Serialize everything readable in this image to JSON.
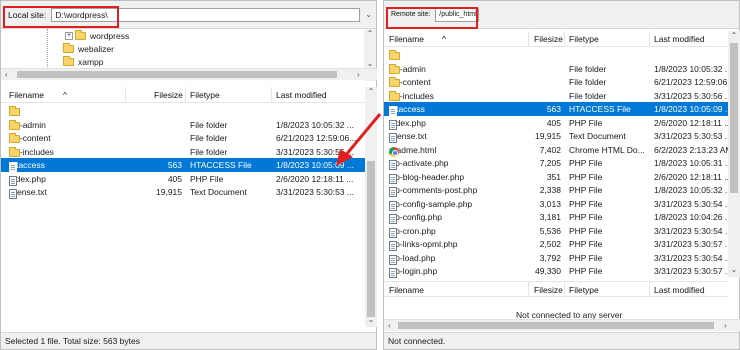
{
  "local": {
    "site_label": "Local site:",
    "site_path": "D:\\wordpress\\",
    "tree": [
      "wordpress",
      "webalizer",
      "xampp"
    ],
    "columns": {
      "filename": "Filename",
      "filesize": "Filesize",
      "filetype": "Filetype",
      "modified": "Last modified"
    },
    "files": [
      {
        "name": "..",
        "size": "",
        "type": "",
        "modified": "",
        "icon": "folder"
      },
      {
        "name": "wp-admin",
        "size": "",
        "type": "File folder",
        "modified": "1/8/2023 10:05:32 ...",
        "icon": "folder"
      },
      {
        "name": "wp-content",
        "size": "",
        "type": "File folder",
        "modified": "6/21/2023 12:59:06...",
        "icon": "folder"
      },
      {
        "name": "wp-includes",
        "size": "",
        "type": "File folder",
        "modified": "3/31/2023 5:30:56 ...",
        "icon": "folder"
      },
      {
        "name": ".htaccess",
        "size": "563",
        "type": "HTACCESS File",
        "modified": "1/8/2023 10:05:09 ...",
        "icon": "file",
        "selected": true
      },
      {
        "name": "index.php",
        "size": "405",
        "type": "PHP File",
        "modified": "2/6/2020 12:18:11 ...",
        "icon": "file"
      },
      {
        "name": "license.txt",
        "size": "19,915",
        "type": "Text Document",
        "modified": "3/31/2023 5:30:53 ...",
        "icon": "file"
      }
    ],
    "status": "Selected 1 file. Total size: 563 bytes"
  },
  "remote": {
    "site_label": "Remote site:",
    "site_path": "/public_html",
    "columns": {
      "filename": "Filename",
      "filesize": "Filesize",
      "filetype": "Filetype",
      "modified": "Last modified"
    },
    "files": [
      {
        "name": "..",
        "size": "",
        "type": "",
        "modified": "",
        "icon": "folder"
      },
      {
        "name": "wp-admin",
        "size": "",
        "type": "File folder",
        "modified": "1/8/2023 10:05:32 ...",
        "icon": "folder"
      },
      {
        "name": "wp-content",
        "size": "",
        "type": "File folder",
        "modified": "6/21/2023 12:59:06...",
        "icon": "folder"
      },
      {
        "name": "wp-includes",
        "size": "",
        "type": "File folder",
        "modified": "3/31/2023 5:30:56 ...",
        "icon": "folder"
      },
      {
        "name": ".htaccess",
        "size": "563",
        "type": "HTACCESS File",
        "modified": "1/8/2023 10:05:09 ...",
        "icon": "file",
        "selected": true
      },
      {
        "name": "index.php",
        "size": "405",
        "type": "PHP File",
        "modified": "2/6/2020 12:18:11 ...",
        "icon": "file"
      },
      {
        "name": "license.txt",
        "size": "19,915",
        "type": "Text Document",
        "modified": "3/31/2023 5:30:53 ...",
        "icon": "file"
      },
      {
        "name": "readme.html",
        "size": "7,402",
        "type": "Chrome HTML Do...",
        "modified": "6/2/2023 2:13:23 AM",
        "icon": "chrome"
      },
      {
        "name": "wp-activate.php",
        "size": "7,205",
        "type": "PHP File",
        "modified": "1/8/2023 10:05:31 ...",
        "icon": "file"
      },
      {
        "name": "wp-blog-header.php",
        "size": "351",
        "type": "PHP File",
        "modified": "2/6/2020 12:18:11 ...",
        "icon": "file"
      },
      {
        "name": "wp-comments-post.php",
        "size": "2,338",
        "type": "PHP File",
        "modified": "1/8/2023 10:05:32 ...",
        "icon": "file"
      },
      {
        "name": "wp-config-sample.php",
        "size": "3,013",
        "type": "PHP File",
        "modified": "3/31/2023 5:30:54 ...",
        "icon": "file"
      },
      {
        "name": "wp-config.php",
        "size": "3,181",
        "type": "PHP File",
        "modified": "1/8/2023 10:04:26 ...",
        "icon": "file"
      },
      {
        "name": "wp-cron.php",
        "size": "5,536",
        "type": "PHP File",
        "modified": "3/31/2023 5:30:54 ...",
        "icon": "file"
      },
      {
        "name": "wp-links-opml.php",
        "size": "2,502",
        "type": "PHP File",
        "modified": "3/31/2023 5:30:57 ...",
        "icon": "file"
      },
      {
        "name": "wp-load.php",
        "size": "3,792",
        "type": "PHP File",
        "modified": "3/31/2023 5:30:54 ...",
        "icon": "file"
      },
      {
        "name": "wp-login.php",
        "size": "49,330",
        "type": "PHP File",
        "modified": "3/31/2023 5:30:57 ...",
        "icon": "file"
      }
    ],
    "queue_columns": {
      "filename": "Filename",
      "filesize": "Filesize",
      "filetype": "Filetype",
      "modified": "Last modified"
    },
    "not_connected_msg": "Not connected to any server",
    "status": "Not connected."
  },
  "colors": {
    "selection": "#0078d7",
    "highlight": "#e02020",
    "folder": "#f7d56a"
  }
}
